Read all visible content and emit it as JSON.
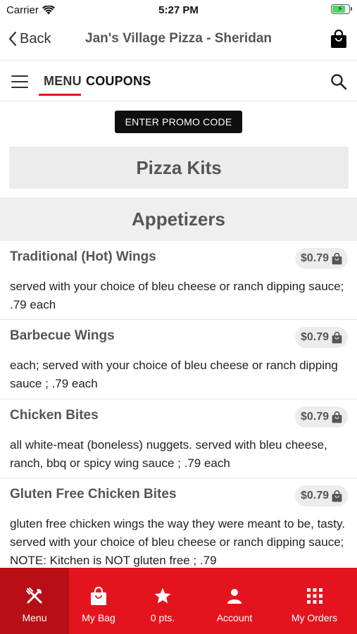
{
  "status": {
    "carrier": "Carrier",
    "time": "5:27 PM",
    "battery_level": 0.8
  },
  "nav": {
    "back_label": "Back",
    "title": "Jan's Village Pizza - Sheridan"
  },
  "tabs": {
    "menu": "MENU",
    "coupons": "COUPONS"
  },
  "promo": {
    "label": "ENTER PROMO CODE"
  },
  "categories": {
    "pizza_kits": "Pizza Kits",
    "appetizers": "Appetizers"
  },
  "items": [
    {
      "name": "Traditional (Hot) Wings",
      "price": "$0.79",
      "description": "served with your choice of bleu cheese or ranch dipping sauce; .79 each"
    },
    {
      "name": "Barbecue Wings",
      "price": "$0.79",
      "description": "each; served with your choice of bleu cheese or ranch dipping sauce ; .79 each"
    },
    {
      "name": "Chicken Bites",
      "price": "$0.79",
      "description": "all white-meat (boneless) nuggets. served with bleu cheese, ranch, bbq or spicy wing sauce ; .79 each"
    },
    {
      "name": "Gluten Free Chicken Bites",
      "price": "$0.79",
      "description": "gluten free chicken wings the way they were meant to be, tasty. served with your choice of bleu cheese or ranch dipping sauce; NOTE: Kitchen is NOT gluten free ; .79"
    }
  ],
  "bottom_tabs": [
    {
      "label": "Menu",
      "icon": "fork-knife-icon"
    },
    {
      "label": "My Bag",
      "icon": "bag-icon"
    },
    {
      "label": "0 pts.",
      "icon": "star-icon"
    },
    {
      "label": "Account",
      "icon": "person-icon"
    },
    {
      "label": "My Orders",
      "icon": "grid-icon"
    }
  ],
  "colors": {
    "accent": "#e4141e",
    "accent_dark": "#b80f16",
    "pill_bg": "#ececec"
  }
}
